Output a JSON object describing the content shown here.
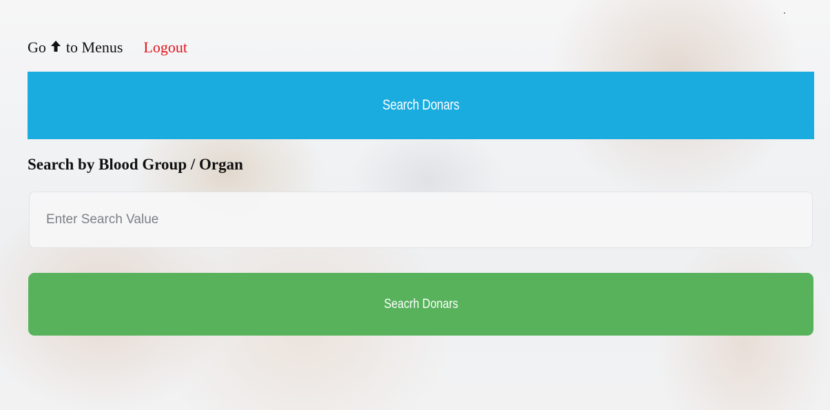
{
  "nav": {
    "go_text": "Go",
    "back_icon": "reply-arrow-icon",
    "menus_text": "to Menus",
    "logout_text": "Logout",
    "logout_color": "#e0141c"
  },
  "header": {
    "title": "Search Donars",
    "color": "#1aabdf"
  },
  "search": {
    "label": "Search by Blood Group / Organ",
    "input_value": "",
    "placeholder": "Enter Search Value",
    "button_label": "Seacrh Donars",
    "button_color": "#57b25b"
  }
}
